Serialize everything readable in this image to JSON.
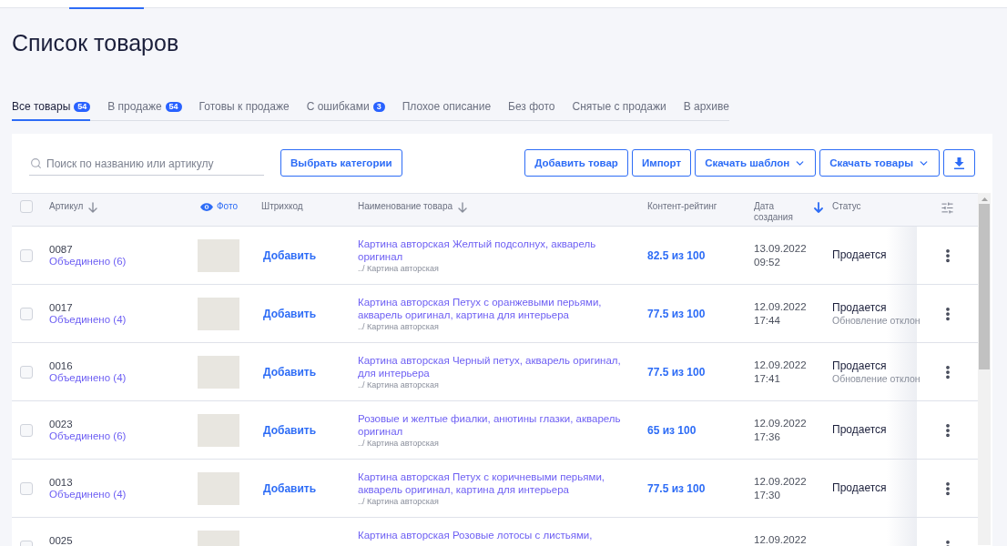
{
  "page": {
    "title": "Список товаров"
  },
  "tabs": [
    {
      "label": "Все товары",
      "badge": "54",
      "selected": true
    },
    {
      "label": "В продаже",
      "badge": "54",
      "selected": false
    },
    {
      "label": "Готовы к продаже",
      "selected": false
    },
    {
      "label": "С ошибками",
      "badge": "3",
      "selected": false
    },
    {
      "label": "Плохое описание",
      "selected": false
    },
    {
      "label": "Без фото",
      "selected": false
    },
    {
      "label": "Снятые с продажи",
      "selected": false
    },
    {
      "label": "В архиве",
      "selected": false
    }
  ],
  "toolbar": {
    "search": {
      "placeholder": "Поиск по названию или артикулу"
    },
    "category_button": "Выбрать категории",
    "actions": [
      {
        "label": "Добавить товар",
        "kind": "plain"
      },
      {
        "label": "Импорт",
        "kind": "plain"
      },
      {
        "label": "Скачать шаблон",
        "kind": "dropdown"
      },
      {
        "label": "Скачать товары",
        "kind": "dropdown"
      }
    ]
  },
  "table": {
    "select_all": {
      "checked": false
    },
    "columns": [
      {
        "label": "Артикул",
        "kind": "plain",
        "sortable": true,
        "sorted": false
      },
      {
        "label": "Фото",
        "kind": "icon_label",
        "sortable": false,
        "sorted": false
      },
      {
        "label": "Штрихкод",
        "kind": "plain",
        "sortable": false,
        "sorted": false
      },
      {
        "label": "Наименование товара",
        "kind": "plain",
        "sortable": true,
        "sorted": false
      },
      {
        "label": "Контент-рейтинг",
        "kind": "plain",
        "sortable": false,
        "sorted": false
      },
      {
        "label": "Дата создания",
        "kind": "plain",
        "sortable": true,
        "sorted": true
      },
      {
        "label": "Статус",
        "kind": "plain",
        "sortable": false,
        "sorted": false
      }
    ],
    "rows": [
      {
        "checked": false,
        "article": "0087",
        "merged": "Объединено (6)",
        "barcode_action": "Добавить",
        "name": "Картина авторская Желтый подсолнух, акварель оригинал",
        "category": "../ Картина авторская",
        "rating": "82.5 из 100",
        "created": "13.09.2022 09:52",
        "status": "Продается"
      },
      {
        "checked": false,
        "article": "0017",
        "merged": "Объединено (4)",
        "barcode_action": "Добавить",
        "name": "Картина авторская Петух с оранжевыми перьями, акварель оригинал, картина для интерьера",
        "category": "../ Картина авторская",
        "rating": "77.5 из 100",
        "created": "12.09.2022 17:44",
        "status": "Продается",
        "status_note": "Обновление отклон"
      },
      {
        "checked": false,
        "article": "0016",
        "merged": "Объединено (4)",
        "barcode_action": "Добавить",
        "name": "Картина авторская Черный петух, акварель оригинал, для интерьера",
        "category": "../ Картина авторская",
        "rating": "77.5 из 100",
        "created": "12.09.2022 17:41",
        "status": "Продается",
        "status_note": "Обновление отклон"
      },
      {
        "checked": false,
        "article": "0023",
        "merged": "Объединено (6)",
        "barcode_action": "Добавить",
        "name": "Розовые и желтые фиалки, анютины глазки, акварель оригинал",
        "category": "../ Картина авторская",
        "rating": "65 из 100",
        "created": "12.09.2022 17:36",
        "status": "Продается"
      },
      {
        "checked": false,
        "article": "0013",
        "merged": "Объединено (4)",
        "barcode_action": "Добавить",
        "name": "Картина авторская Петух с коричневыми перьями, акварель оригинал, картина для интерьера",
        "category": "../ Картина авторская",
        "rating": "77.5 из 100",
        "created": "12.09.2022 17:30",
        "status": "Продается"
      },
      {
        "checked": false,
        "article": "0025",
        "name": "Картина авторская Розовые лотосы с листьями,",
        "created": "12.09.2022"
      }
    ]
  }
}
